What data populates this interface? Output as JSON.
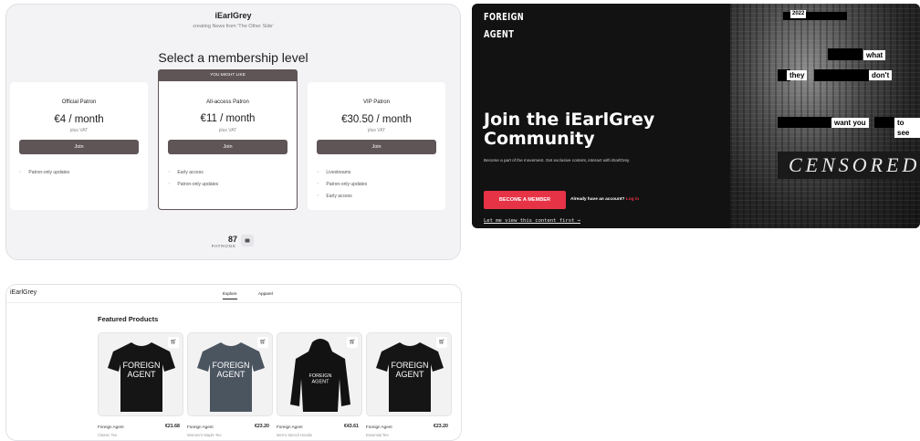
{
  "membership": {
    "creator_name": "iEarlGrey",
    "tagline": "creating News from 'The Other Side'",
    "heading": "Select a membership level",
    "tiers": [
      {
        "name": "Official Patron",
        "price": "€4 / month",
        "vat": "plus VAT",
        "join": "Join",
        "benefits": [
          "Patron-only updates"
        ]
      },
      {
        "name": "All-access Patron",
        "price": "€11 / month",
        "vat": "plus VAT",
        "join": "Join",
        "badge": "YOU MIGHT LIKE",
        "benefits": [
          "Early access",
          "Patron-only updates"
        ]
      },
      {
        "name": "VIP Patron",
        "price": "€30.50 / month",
        "vat": "plus VAT",
        "join": "Join",
        "benefits": [
          "Livestreams",
          "Patron-only updates",
          "Early access"
        ]
      }
    ],
    "patron_count": "87",
    "patron_label": "PATRONS"
  },
  "hero": {
    "logo_line1": "FOREIGN",
    "logo_line2": "AGENT",
    "title": "Join the iEarlGrey Community",
    "description": "Become a part of the movement. Get exclusive content, interact with iEarlGrey.",
    "cta": "BECOME A MEMBER",
    "already_text": "Already have an account?",
    "login": "Log in",
    "preview_link": "Let me view this content first →",
    "art": {
      "year": "2022",
      "words": [
        "what",
        "they",
        "don't",
        "want you",
        "to see"
      ],
      "censored": "CENSORED"
    }
  },
  "shop": {
    "name": "iEarlGrey",
    "nav": [
      "Explore",
      "Apparel"
    ],
    "featured": "Featured Products",
    "products": [
      {
        "name": "Foreign Agent",
        "subtitle": "Classic Tee",
        "price": "€21.68",
        "print": [
          "FOREIGN",
          "AGENT"
        ],
        "color": "#151515",
        "kind": "tee"
      },
      {
        "name": "Foreign Agent",
        "subtitle": "Women's Maple Tee",
        "price": "€23.20",
        "print": [
          "FOREIGN",
          "AGENT"
        ],
        "color": "#4b5560",
        "kind": "tee"
      },
      {
        "name": "Foreign Agent",
        "subtitle": "Men's Stencil Hoodie",
        "price": "€43.61",
        "print": [
          "FOREIGN",
          "AGENT"
        ],
        "color": "#121212",
        "kind": "hoodie"
      },
      {
        "name": "Foreign Agent",
        "subtitle": "Essential Tee",
        "price": "€23.20",
        "print": [
          "FOREIGN",
          "AGENT"
        ],
        "color": "#151515",
        "kind": "tee"
      }
    ]
  },
  "icons": {
    "cart": "cart-icon",
    "preview": "preview-icon"
  }
}
